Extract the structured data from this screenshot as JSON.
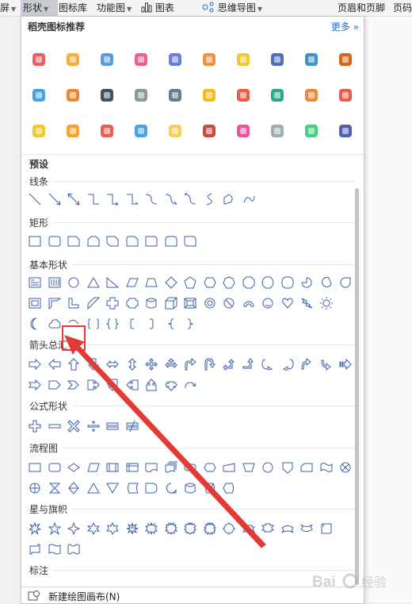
{
  "toolbar": {
    "items": [
      "屏",
      "形状",
      "图标库",
      "功能图",
      "图表",
      "思维导图",
      "页眉和页脚",
      "页码"
    ]
  },
  "panel": {
    "title": "稻壳图标推荐",
    "more": "更多",
    "preset_label": "预设",
    "sections": {
      "lines": "线条",
      "rect": "矩形",
      "basic": "基本形状",
      "arrows": "箭头总汇",
      "equation": "公式形状",
      "flowchart": "流程图",
      "stars": "星与旗帜",
      "callouts": "标注"
    },
    "footer": "新建绘图画布(N)"
  },
  "watermark": "Bai 经验",
  "colors": {
    "shape_stroke": "#3b5fa8",
    "link": "#1f6fd6",
    "highlight": "#e53935",
    "arrow": "#e53935"
  },
  "selected_shape": "cloud",
  "recommended_icons": [
    "firework-icon",
    "lightbulb-icon",
    "laptop-icon",
    "heart-pulse-icon",
    "phone-doc-icon",
    "padlock-icon",
    "trophy-icon",
    "document-icon",
    "magnifier-icon",
    "camera-icon",
    "location-icon",
    "target-icon",
    "network-icon",
    "browser-icon",
    "buildings-icon",
    "idea-head-icon",
    "team-icon",
    "mountain-flag-icon",
    "molecule-icon",
    "box-icon",
    "clipboard-icon",
    "notebook-icon",
    "gift-icon",
    "pencil-icon",
    "cake-icon",
    "growth-chart-icon",
    "dna-icon",
    "calendar-icon",
    "flags-icon",
    "stock-candle-icon"
  ]
}
